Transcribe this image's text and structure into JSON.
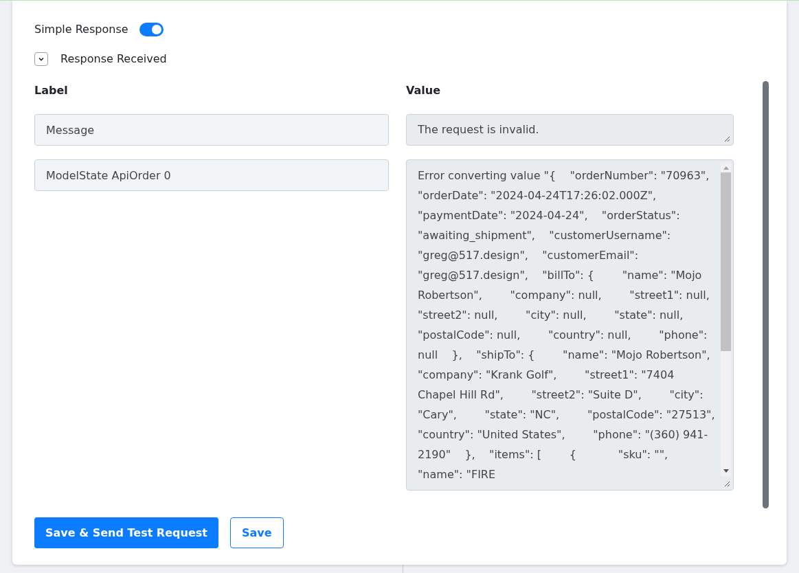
{
  "simple_response": {
    "label": "Simple Response",
    "on": true
  },
  "response_received": {
    "label": "Response Received",
    "expanded": true
  },
  "columns": [
    "Label",
    "Value"
  ],
  "rows": [
    {
      "label": "Message",
      "value": "The request is invalid.",
      "kind": "short"
    },
    {
      "label": "ModelState ApiOrder 0",
      "value": "Error converting value \"{    \"orderNumber\": \"70963\",    \"orderDate\": \"2024-04-24T17:26:02.000Z\",    \"paymentDate\": \"2024-04-24\",    \"orderStatus\": \"awaiting_shipment\",    \"customerUsername\": \"greg@517.design\",    \"customerEmail\": \"greg@517.design\",    \"billTo\": {        \"name\": \"Mojo Robertson\",        \"company\": null,        \"street1\": null,        \"street2\": null,        \"city\": null,        \"state\": null,        \"postalCode\": null,        \"country\": null,        \"phone\": null    },    \"shipTo\": {        \"name\": \"Mojo Robertson\",        \"company\": \"Krank Golf\",        \"street1\": \"7404 Chapel Hill Rd\",        \"street2\": \"Suite D\",        \"city\": \"Cary\",        \"state\": \"NC\",        \"postalCode\": \"27513\",        \"country\": \"United States\",        \"phone\": \"(360) 941-2190\"    },    \"items\": [        {            \"sku\": \"\",            \"name\": \"FIRE",
      "kind": "scrolling"
    }
  ],
  "buttons": [
    {
      "label": "Save & Send Test Request",
      "kind": "primary"
    },
    {
      "label": "Save",
      "kind": "outline"
    }
  ]
}
